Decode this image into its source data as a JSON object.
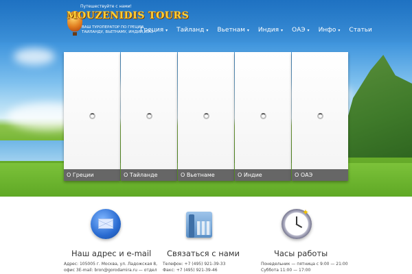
{
  "logo": {
    "tagline_top": "Путешествуйте с нами!",
    "name": "MOUZENIDIS TOURS",
    "subtitle": "ВАШ ТУРОПЕРАТОР ПО ГРЕЦИИ, ТАИЛАНДУ, ВЬЕТНАМУ, ИНДИИ, ОАЭ"
  },
  "nav": {
    "items": [
      {
        "label": "Греция",
        "has_dropdown": true
      },
      {
        "label": "Тайланд",
        "has_dropdown": true
      },
      {
        "label": "Вьетнам",
        "has_dropdown": true
      },
      {
        "label": "Индия",
        "has_dropdown": true
      },
      {
        "label": "ОАЭ",
        "has_dropdown": true
      },
      {
        "label": "Инфо",
        "has_dropdown": true
      },
      {
        "label": "Статьи",
        "has_dropdown": false
      }
    ],
    "caret": "▾"
  },
  "cards": [
    {
      "caption": "О Греции"
    },
    {
      "caption": "О Тайланде"
    },
    {
      "caption": "О Вьетнаме"
    },
    {
      "caption": "О Индие"
    },
    {
      "caption": "О ОАЭ"
    }
  ],
  "info": {
    "address": {
      "title": "Наш адрес и e-mail",
      "lines": [
        "Адрес: 105005 г. Москва, ул. Ладожская 8,",
        "офис 3E-mail: bron@gorodamira.ru — отдел"
      ]
    },
    "contact": {
      "title": "Связаться с нами",
      "lines": [
        "Телефон: +7 (495) 921-39-33",
        "Факс: +7 (495) 921-39-46"
      ]
    },
    "hours": {
      "title": "Часы работы",
      "lines": [
        "Понедельник — пятница с 9:00 — 21:00",
        "Суббота 11:00 — 17:00"
      ]
    }
  },
  "colors": {
    "caption_bg": "#666666",
    "logo_gold": "#ffd23a",
    "sky_top": "#1f76c7"
  }
}
